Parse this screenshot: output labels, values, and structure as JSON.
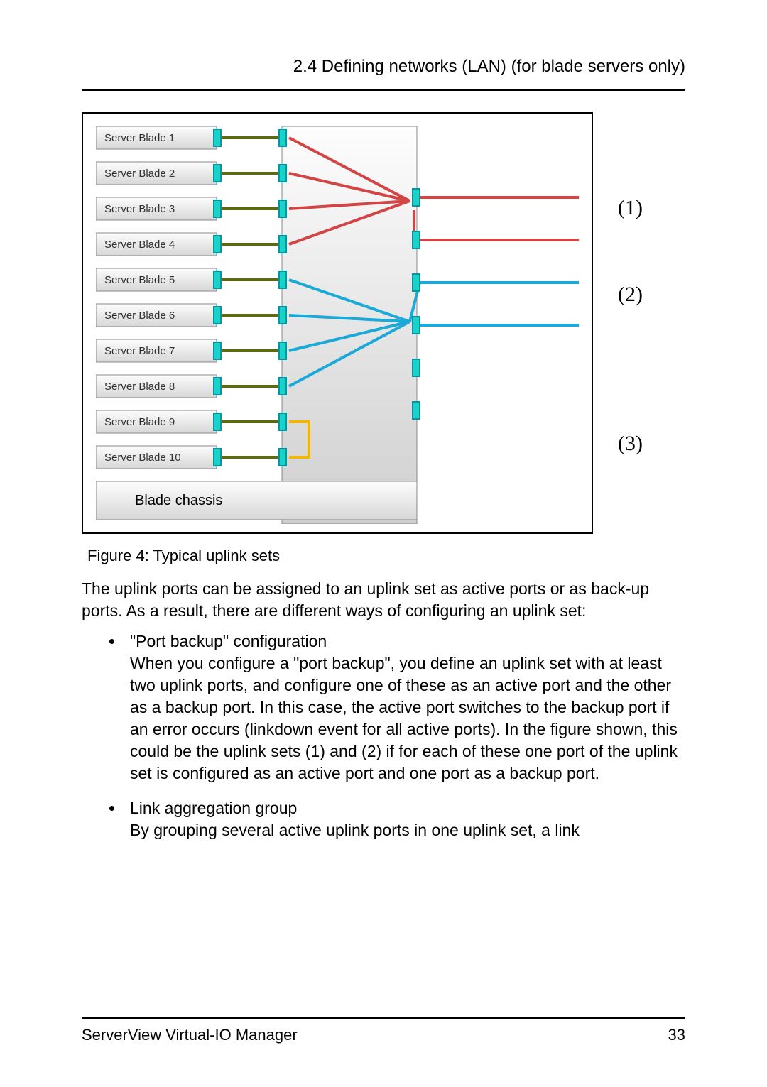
{
  "header": {
    "section_title": "2.4 Defining networks (LAN) (for blade servers only)"
  },
  "figure": {
    "blades": [
      "Server Blade 1",
      "Server Blade 2",
      "Server Blade 3",
      "Server Blade 4",
      "Server Blade 5",
      "Server Blade 6",
      "Server Blade 7",
      "Server Blade 8",
      "Server Blade 9",
      "Server Blade 10"
    ],
    "chassis_label": "Blade chassis",
    "annotations": {
      "a1": "(1)",
      "a2": "(2)",
      "a3": "(3)"
    },
    "caption": "Figure 4: Typical uplink sets"
  },
  "body": {
    "intro": "The uplink ports can be assigned to an uplink set as active ports or as back-up ports. As a result, there are different ways of configuring an uplink set:",
    "item1_title": "\"Port backup\" configuration",
    "item1_body": "When you configure a \"port backup\", you define an uplink set with at least two uplink ports, and configure one of these as an active port and the other as a backup port. In this case, the active port switches to the backup port if an error occurs (linkdown event for all active ports). In the figure shown, this could be the uplink sets (1) and (2) if for each of these one port of the uplink set is configured as an active port and one port as a backup port.",
    "item2_title": "Link aggregation group",
    "item2_body": "By grouping several active uplink ports in one uplink set, a link"
  },
  "footer": {
    "doc_title": "ServerView Virtual-IO Manager",
    "page_number": "33"
  },
  "colors": {
    "red": "#d34545",
    "cyan": "#1aa9d8",
    "yellow": "#f5b400",
    "olive": "#5b6b0e",
    "teal_port": "#19d2c8",
    "teal_stroke": "#0096a3"
  }
}
